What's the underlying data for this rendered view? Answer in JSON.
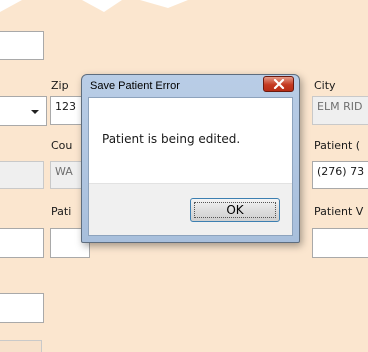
{
  "form": {
    "zip_label": "Zip",
    "zip_value": "123",
    "city_label": "City",
    "city_value": "ELM RID",
    "county_label": "Cou",
    "county_value": "WA",
    "patient_phone_label": "Patient (",
    "patient_phone_value": "(276) 73",
    "patient_left_label": "Pati",
    "patient_right_label": "Patient V"
  },
  "dialog": {
    "title": "Save Patient Error",
    "message": "Patient is being edited.",
    "ok_label": "OK"
  },
  "icons": {
    "combo_arrow": "chevron-down-icon",
    "close": "close-icon"
  },
  "colors": {
    "form_background": "#fbe6cf",
    "close_button": "#c53a22",
    "dialog_frame": "#b9cde6"
  }
}
